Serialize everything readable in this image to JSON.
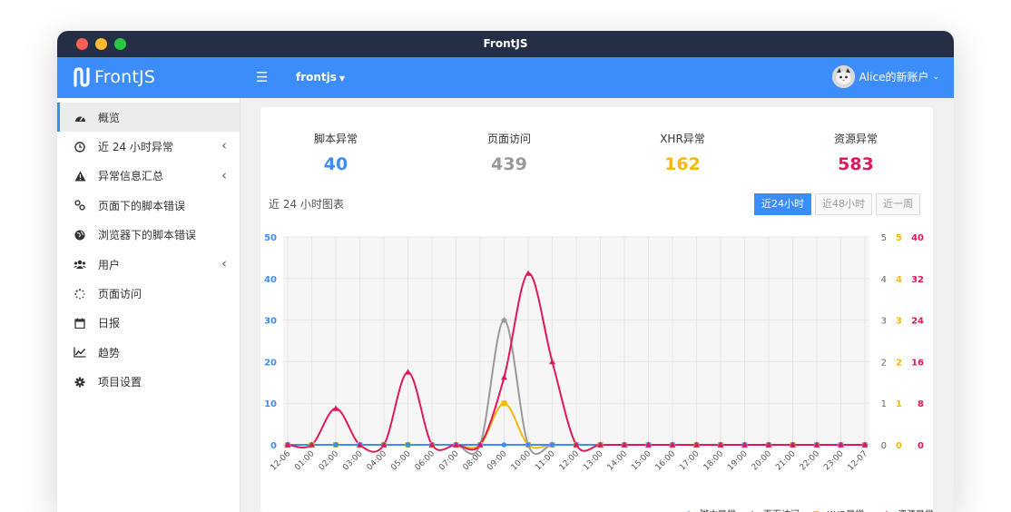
{
  "window": {
    "title": "FrontJS"
  },
  "topbar": {
    "brand": "FrontJS",
    "project": "frontjs",
    "user": "Alice的新账户"
  },
  "sidebar": {
    "items": [
      {
        "label": "概览",
        "icon": "dashboard-icon",
        "active": true
      },
      {
        "label": "近 24 小时异常",
        "icon": "clock-icon",
        "chevron": true
      },
      {
        "label": "异常信息汇总",
        "icon": "warning-icon",
        "chevron": true
      },
      {
        "label": "页面下的脚本错误",
        "icon": "link-icon"
      },
      {
        "label": "浏览器下的脚本错误",
        "icon": "globe-icon"
      },
      {
        "label": "用户",
        "icon": "users-icon",
        "chevron": true
      },
      {
        "label": "页面访问",
        "icon": "spinner-icon"
      },
      {
        "label": "日报",
        "icon": "calendar-icon"
      },
      {
        "label": "趋势",
        "icon": "line-chart-icon"
      },
      {
        "label": "项目设置",
        "icon": "gear-icon"
      }
    ]
  },
  "stats": [
    {
      "label": "脚本异常",
      "value": "40",
      "color": "#3c8dfa"
    },
    {
      "label": "页面访问",
      "value": "439",
      "color": "#999999"
    },
    {
      "label": "XHR异常",
      "value": "162",
      "color": "#f5b90a"
    },
    {
      "label": "资源异常",
      "value": "583",
      "color": "#e0185a"
    }
  ],
  "chart": {
    "title": "近 24 小时图表",
    "ranges": [
      {
        "label": "近24小时",
        "active": true
      },
      {
        "label": "近48小时",
        "active": false
      },
      {
        "label": "近一周",
        "active": false
      }
    ]
  },
  "chart_data": {
    "type": "line",
    "categories": [
      "12-06",
      "01:00",
      "02:00",
      "03:00",
      "04:00",
      "05:00",
      "06:00",
      "07:00",
      "08:00",
      "09:00",
      "10:00",
      "11:00",
      "12:00",
      "13:00",
      "14:00",
      "15:00",
      "16:00",
      "17:00",
      "18:00",
      "19:00",
      "20:00",
      "21:00",
      "22:00",
      "23:00",
      "12-07"
    ],
    "series": [
      {
        "name": "脚本异常",
        "color": "#3c8dfa",
        "axis": "left",
        "marker": "circle",
        "values": [
          0,
          0,
          0,
          0,
          0,
          0,
          0,
          0,
          0,
          0,
          0,
          0,
          0,
          0,
          0,
          0,
          0,
          0,
          0,
          0,
          0,
          0,
          0,
          0,
          0
        ]
      },
      {
        "name": "页面访问",
        "color": "#999999",
        "axis": "left",
        "marker": "diamond",
        "values": [
          0,
          0,
          0,
          0,
          0,
          0,
          0,
          0,
          0,
          30,
          0,
          0,
          0,
          0,
          0,
          0,
          0,
          0,
          0,
          0,
          0,
          0,
          0,
          0,
          0
        ]
      },
      {
        "name": "XHR异常",
        "color": "#f5b90a",
        "axis": "right1",
        "marker": "square",
        "values": [
          0,
          0,
          0,
          0,
          0,
          0,
          0,
          0,
          0,
          1,
          0,
          0,
          0,
          0,
          0,
          0,
          0,
          0,
          0,
          0,
          0,
          0,
          0,
          0,
          0
        ]
      },
      {
        "name": "资源异常",
        "color": "#e0185a",
        "axis": "right2",
        "marker": "triangle",
        "values": [
          0,
          0,
          7,
          0,
          0,
          14,
          0,
          0,
          0,
          13,
          33,
          16,
          0,
          0,
          0,
          0,
          0,
          0,
          0,
          0,
          0,
          0,
          0,
          0,
          0
        ]
      }
    ],
    "axes": {
      "left": {
        "ticks": [
          "0",
          "10",
          "20",
          "30",
          "40",
          "50"
        ],
        "range": [
          0,
          50
        ],
        "color": "#3c8dfa"
      },
      "right0": {
        "ticks": [
          "0",
          "1",
          "2",
          "3",
          "4",
          "5"
        ],
        "range": [
          0,
          5
        ],
        "color": "#666666"
      },
      "right1": {
        "ticks": [
          "0",
          "1",
          "2",
          "3",
          "4",
          "5"
        ],
        "range": [
          0,
          5
        ],
        "color": "#f5b90a"
      },
      "right2": {
        "ticks": [
          "0",
          "8",
          "16",
          "24",
          "32",
          "40"
        ],
        "range": [
          0,
          40
        ],
        "color": "#e0185a"
      }
    },
    "grid": true,
    "legend": "bottom-right"
  }
}
